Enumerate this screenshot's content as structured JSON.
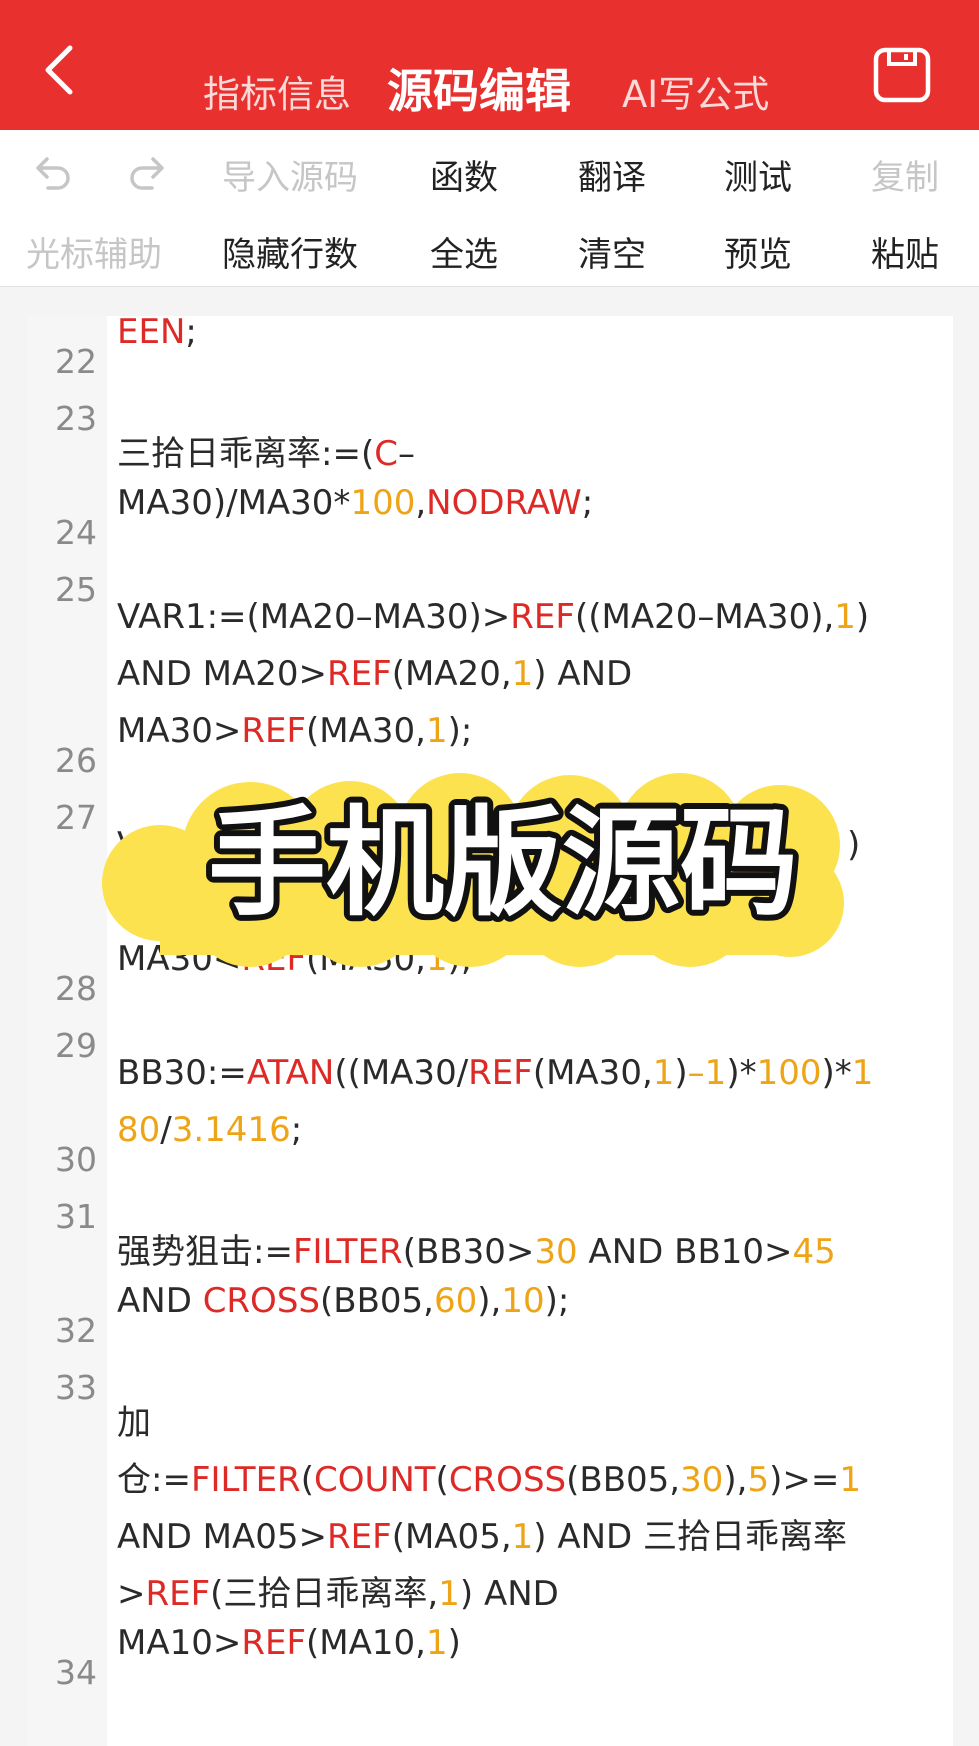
{
  "header": {
    "tabs": [
      {
        "label": "指标信息"
      },
      {
        "label": "源码编辑"
      },
      {
        "label": "AI写公式"
      }
    ],
    "colors": {
      "accent": "#e8312f",
      "keyword": "#dd2a26",
      "number": "#eea417"
    }
  },
  "toolbar": {
    "row1": {
      "undo_icon": "undo-icon",
      "redo_icon": "redo-icon",
      "import_label": "导入源码",
      "functions_label": "函数",
      "translate_label": "翻译",
      "test_label": "测试",
      "copy_label": "复制"
    },
    "row2": {
      "cursor_label": "光标辅助",
      "hide_lines_label": "隐藏行数",
      "select_all_label": "全选",
      "clear_label": "清空",
      "preview_label": "预览",
      "paste_label": "粘贴"
    }
  },
  "editor": {
    "line_numbers": [
      "22",
      "23",
      "24",
      "25",
      "26",
      "27",
      "28",
      "29",
      "30",
      "31",
      "32",
      "33",
      "34"
    ],
    "lines": [
      [
        {
          "t": "EEN",
          "c": "k"
        },
        {
          "t": ";"
        }
      ],
      [
        {
          "t": "三拾日乖离率:=("
        },
        {
          "t": "C",
          "c": "k"
        },
        {
          "t": "–"
        }
      ],
      [
        {
          "t": "MA30)/MA30*"
        },
        {
          "t": "100",
          "c": "n"
        },
        {
          "t": ","
        },
        {
          "t": "NODRAW",
          "c": "k"
        },
        {
          "t": ";"
        }
      ],
      [
        {
          "t": "VAR1:=(MA20–MA30)>"
        },
        {
          "t": "REF",
          "c": "k"
        },
        {
          "t": "((MA20–MA30),"
        },
        {
          "t": "1",
          "c": "n"
        },
        {
          "t": ")"
        }
      ],
      [
        {
          "t": "AND MA20>"
        },
        {
          "t": "REF",
          "c": "k"
        },
        {
          "t": "(MA20,"
        },
        {
          "t": "1",
          "c": "n"
        },
        {
          "t": ") AND"
        }
      ],
      [
        {
          "t": "MA30>"
        },
        {
          "t": "REF",
          "c": "k"
        },
        {
          "t": "(MA30,"
        },
        {
          "t": "1",
          "c": "n"
        },
        {
          "t": ");"
        }
      ],
      [
        {
          "t": "VA"
        }
      ],
      [
        {
          "t": ")"
        }
      ],
      [
        {
          "t": "MA30<"
        },
        {
          "t": "REF",
          "c": "k"
        },
        {
          "t": "(MA30,"
        },
        {
          "t": "1",
          "c": "n"
        },
        {
          "t": ");"
        }
      ],
      [
        {
          "t": "BB30:="
        },
        {
          "t": "ATAN",
          "c": "k"
        },
        {
          "t": "((MA30/"
        },
        {
          "t": "REF",
          "c": "k"
        },
        {
          "t": "(MA30,"
        },
        {
          "t": "1",
          "c": "n"
        },
        {
          "t": ")"
        },
        {
          "t": "–1",
          "c": "n"
        },
        {
          "t": ")*"
        },
        {
          "t": "100",
          "c": "n"
        },
        {
          "t": ")*"
        },
        {
          "t": "1",
          "c": "n"
        }
      ],
      [
        {
          "t": "80",
          "c": "n"
        },
        {
          "t": "/"
        },
        {
          "t": "3.1416",
          "c": "n"
        },
        {
          "t": ";"
        }
      ],
      [
        {
          "t": "强势狙击:="
        },
        {
          "t": "FILTER",
          "c": "k"
        },
        {
          "t": "(BB30>"
        },
        {
          "t": "30",
          "c": "n"
        },
        {
          "t": " AND BB10>"
        },
        {
          "t": "45",
          "c": "n"
        }
      ],
      [
        {
          "t": "AND "
        },
        {
          "t": "CROSS",
          "c": "k"
        },
        {
          "t": "(BB05,"
        },
        {
          "t": "60",
          "c": "n"
        },
        {
          "t": "),"
        },
        {
          "t": "10",
          "c": "n"
        },
        {
          "t": ");"
        }
      ],
      [
        {
          "t": "加"
        }
      ],
      [
        {
          "t": "仓:="
        },
        {
          "t": "FILTER",
          "c": "k"
        },
        {
          "t": "("
        },
        {
          "t": "COUNT",
          "c": "k"
        },
        {
          "t": "("
        },
        {
          "t": "CROSS",
          "c": "k"
        },
        {
          "t": "(BB05,"
        },
        {
          "t": "30",
          "c": "n"
        },
        {
          "t": "),"
        },
        {
          "t": "5",
          "c": "n"
        },
        {
          "t": ")>="
        },
        {
          "t": "1",
          "c": "n"
        }
      ],
      [
        {
          "t": "AND MA05>"
        },
        {
          "t": "REF",
          "c": "k"
        },
        {
          "t": "(MA05,"
        },
        {
          "t": "1",
          "c": "n"
        },
        {
          "t": ") AND 三拾日乖离率"
        }
      ],
      [
        {
          "t": ">"
        },
        {
          "t": "REF",
          "c": "k"
        },
        {
          "t": "(三拾日乖离率,"
        },
        {
          "t": "1",
          "c": "n"
        },
        {
          "t": ") AND"
        }
      ],
      [
        {
          "t": "MA10>"
        },
        {
          "t": "REF",
          "c": "k"
        },
        {
          "t": "(MA10,"
        },
        {
          "t": "1",
          "c": "n"
        },
        {
          "t": ")"
        }
      ]
    ]
  },
  "overlay": {
    "title": "手机版源码",
    "highlight_color": "#fde24f"
  }
}
